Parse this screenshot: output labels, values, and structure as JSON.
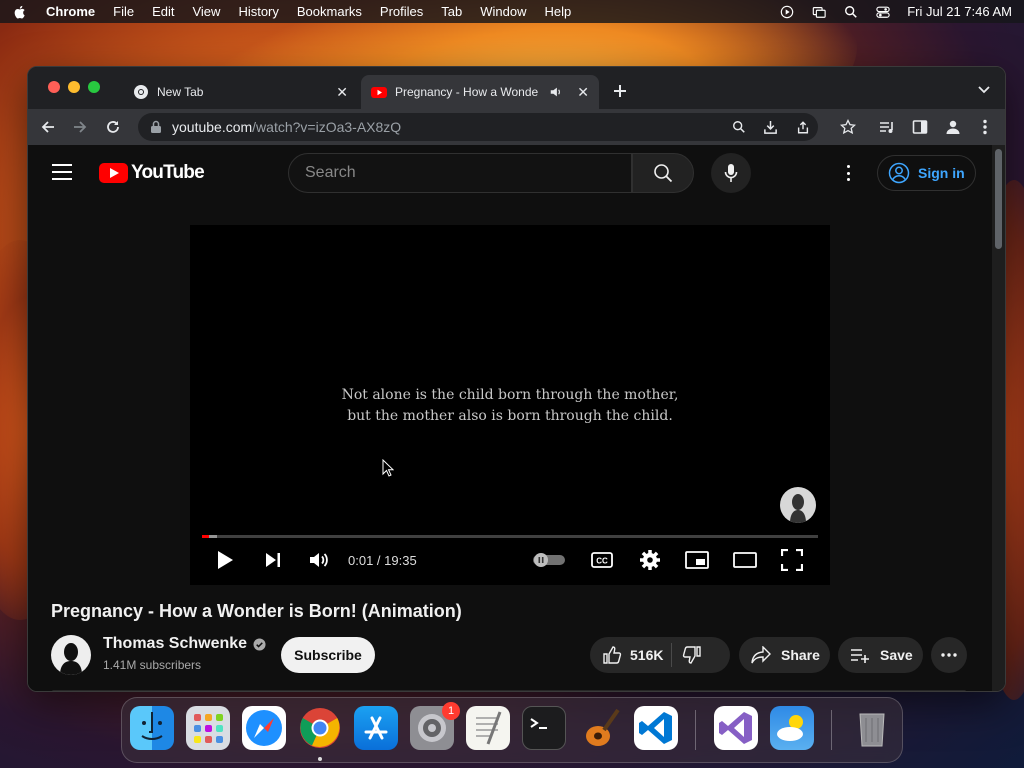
{
  "menubar": {
    "app": "Chrome",
    "items": [
      "File",
      "Edit",
      "View",
      "History",
      "Bookmarks",
      "Profiles",
      "Tab",
      "Window",
      "Help"
    ],
    "clock": "Fri Jul 21  7:46 AM"
  },
  "browser": {
    "tabs": [
      {
        "title": "New Tab",
        "icon": "chrome-icon"
      },
      {
        "title": "Pregnancy - How a Wonde",
        "icon": "youtube-icon",
        "audio": true
      }
    ],
    "url": {
      "host": "youtube.com",
      "path": "/watch?v=izOa3-AX8zQ"
    }
  },
  "youtube": {
    "logo_text": "YouTube",
    "search_placeholder": "Search",
    "sign_in": "Sign in",
    "player": {
      "quote_line1": "Not alone is the child born through the mother,",
      "quote_line2": "but the mother also is born through the child.",
      "time": "0:01 / 19:35",
      "progress": 0.012
    },
    "video": {
      "title": "Pregnancy - How a Wonder is Born! (Animation)",
      "channel": "Thomas Schwenke",
      "subscribers": "1.41M subscribers",
      "subscribe": "Subscribe",
      "likes": "516K",
      "share": "Share",
      "save": "Save"
    }
  },
  "dock": {
    "apps": [
      "finder",
      "launchpad",
      "safari",
      "chrome",
      "app-store",
      "system-settings",
      "textedit",
      "terminal",
      "garageband",
      "vscode",
      "visual-studio",
      "weather",
      "trash"
    ],
    "settings_badge": "1"
  },
  "colors": {
    "accent_red": "#ff0000",
    "link_blue": "#3ea6ff",
    "bg": "#0f0f0f"
  }
}
